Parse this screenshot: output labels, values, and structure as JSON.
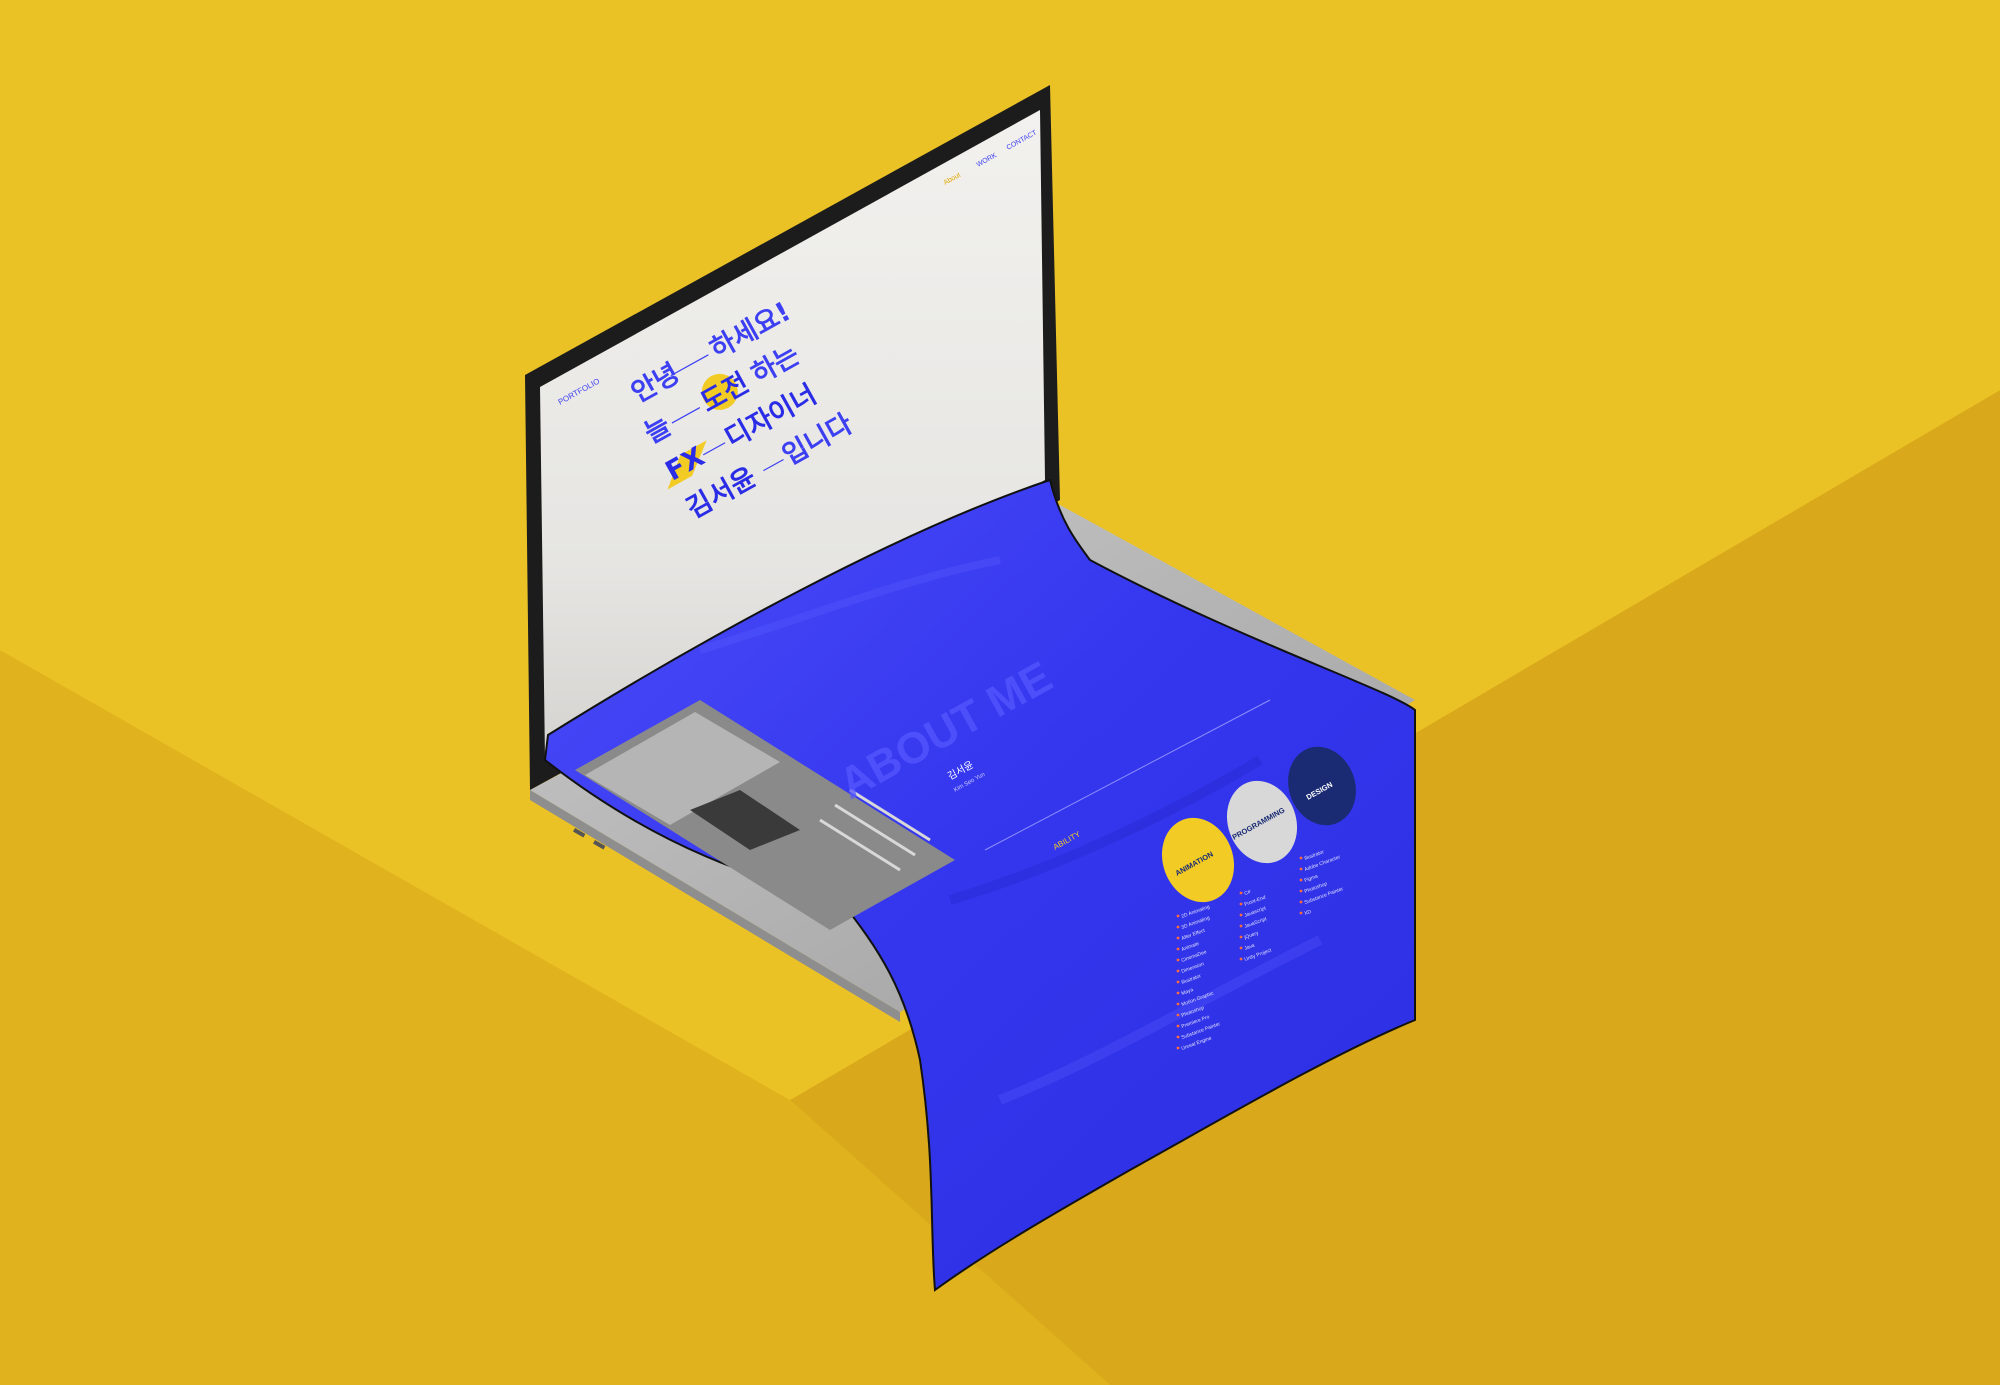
{
  "colors": {
    "background": "#e9bd22",
    "cube_left": "#e2b41e",
    "cube_right": "#dcab1b",
    "accent_blue": "#3d3ff2",
    "accent_yellow": "#f2cc24",
    "navy": "#1a2b73",
    "screen_bg": "#ecebe8"
  },
  "header": {
    "logo": "PORTFOLIO",
    "nav": [
      "About",
      "WORK",
      "CONTACT"
    ]
  },
  "hero": {
    "line1_a": "안녕",
    "line1_b": "하세요!",
    "line2_a": "늘",
    "line2_b": "도전",
    "line2_c": "하는",
    "line3_a": "FX",
    "line3_b": "디자이너",
    "line4_a": "김서윤",
    "line4_b": "입니다"
  },
  "about": {
    "title": "ABOUT ME",
    "name": "김서윤",
    "name_en": "Kim Seo Yun",
    "ability": "ABILITY"
  },
  "skills": [
    {
      "label": "ANIMATION",
      "color": "#f2cc24",
      "items": [
        "2D Animating",
        "3D Animating",
        "After Effect",
        "Animate",
        "CinemaDee",
        "Dimension",
        "Illustrator",
        "Maya",
        "Motion Graphic",
        "Photoshop",
        "Premiere Pro",
        "Substance Painter",
        "Unreal Engine"
      ]
    },
    {
      "label": "PROGRAMMING",
      "color": "#d8d8d8",
      "items": [
        "C#",
        "Front-End",
        "Javascript",
        "JavaScript",
        "jQuery",
        "Java",
        "Unity Project"
      ]
    },
    {
      "label": "DESIGN",
      "color": "#1a2b73",
      "items": [
        "Illustrator",
        "Adobe Character",
        "Figma",
        "Photoshop",
        "Substance Painter",
        "XD"
      ]
    }
  ]
}
